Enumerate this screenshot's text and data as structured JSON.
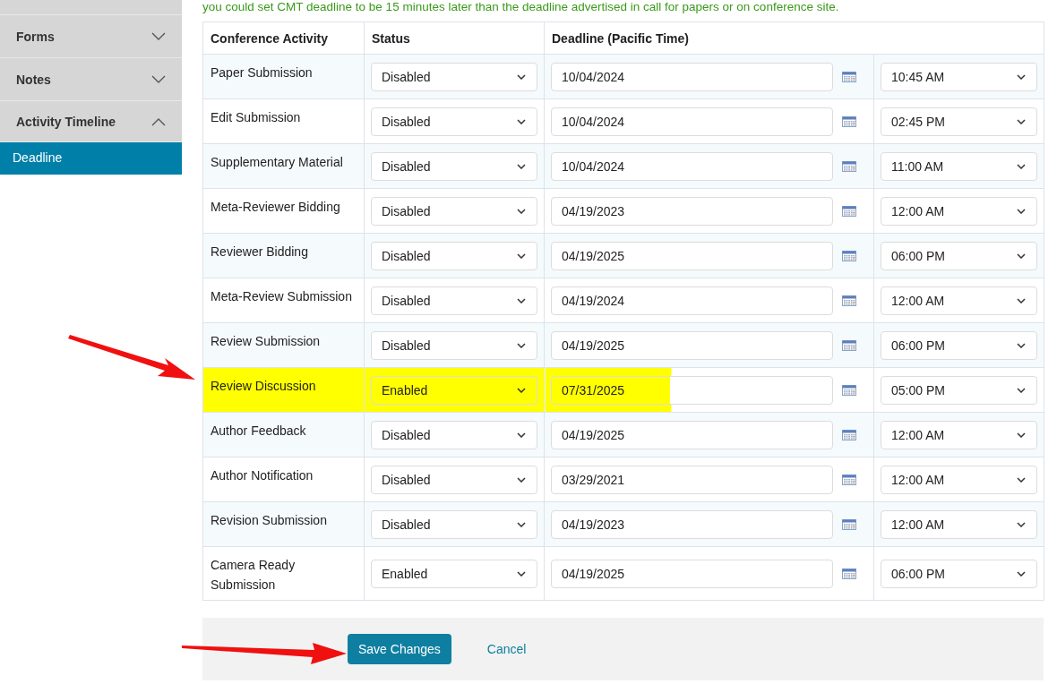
{
  "note": "you could set CMT deadline to be 15 minutes later than the deadline advertised in call for papers or on conference site.",
  "sidebar": {
    "items": [
      {
        "label": "Forms",
        "expanded": false
      },
      {
        "label": "Notes",
        "expanded": false
      },
      {
        "label": "Activity Timeline",
        "expanded": true,
        "children": [
          {
            "label": "Deadline",
            "selected": true
          }
        ]
      }
    ]
  },
  "table": {
    "columns": [
      "Conference Activity",
      "Status",
      "Deadline (Pacific Time)"
    ],
    "rows": [
      {
        "activity": "Paper Submission",
        "status": "Disabled",
        "date": "10/04/2024",
        "time": "10:45 AM",
        "highlighted": false
      },
      {
        "activity": "Edit Submission",
        "status": "Disabled",
        "date": "10/04/2024",
        "time": "02:45 PM",
        "highlighted": false
      },
      {
        "activity": "Supplementary Material",
        "status": "Disabled",
        "date": "10/04/2024",
        "time": "11:00 AM",
        "highlighted": false
      },
      {
        "activity": "Meta-Reviewer Bidding",
        "status": "Disabled",
        "date": "04/19/2023",
        "time": "12:00 AM",
        "highlighted": false
      },
      {
        "activity": "Reviewer Bidding",
        "status": "Disabled",
        "date": "04/19/2025",
        "time": "06:00 PM",
        "highlighted": false
      },
      {
        "activity": "Meta-Review Submission",
        "status": "Disabled",
        "date": "04/19/2024",
        "time": "12:00 AM",
        "highlighted": false
      },
      {
        "activity": "Review Submission",
        "status": "Disabled",
        "date": "04/19/2025",
        "time": "06:00 PM",
        "highlighted": false
      },
      {
        "activity": "Review Discussion",
        "status": "Enabled",
        "date": "07/31/2025",
        "time": "05:00 PM",
        "highlighted": true
      },
      {
        "activity": "Author Feedback",
        "status": "Disabled",
        "date": "04/19/2025",
        "time": "12:00 AM",
        "highlighted": false
      },
      {
        "activity": "Author Notification",
        "status": "Disabled",
        "date": "03/29/2021",
        "time": "12:00 AM",
        "highlighted": false
      },
      {
        "activity": "Revision Submission",
        "status": "Disabled",
        "date": "04/19/2023",
        "time": "12:00 AM",
        "highlighted": false
      },
      {
        "activity": "Camera Ready Submission",
        "status": "Enabled",
        "date": "04/19/2025",
        "time": "06:00 PM",
        "highlighted": false
      }
    ]
  },
  "buttons": {
    "save": "Save Changes",
    "cancel": "Cancel"
  }
}
